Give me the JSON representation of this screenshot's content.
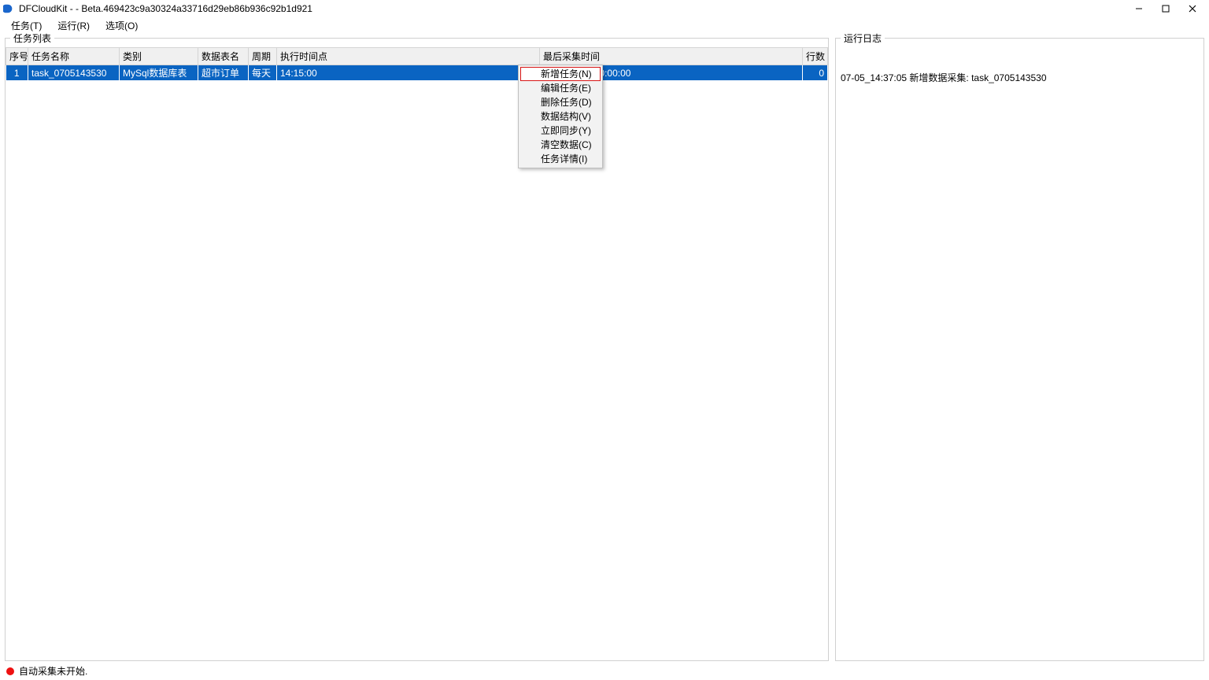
{
  "window": {
    "title": "DFCloudKit - - Beta.469423c9a30324a33716d29eb86b936c92b1d921"
  },
  "menubar": {
    "items": [
      {
        "label": "任务(T)"
      },
      {
        "label": "运行(R)"
      },
      {
        "label": "选项(O)"
      }
    ]
  },
  "panels": {
    "task_list_title": "任务列表",
    "log_title": "运行日志"
  },
  "task_table": {
    "columns": {
      "idx": "序号",
      "name": "任务名称",
      "type": "类别",
      "table": "数据表名",
      "period": "周期",
      "exec_time": "执行时间点",
      "last_collect": "最后采集时间",
      "rows": "行数"
    },
    "rows": [
      {
        "idx": "1",
        "name": "task_0705143530",
        "type": "MySql数据库表",
        "table": "超市订单",
        "period": "每天",
        "exec_time": "14:15:00",
        "last_collect": "0001-01-01 00:00:00",
        "row_count": "0"
      }
    ]
  },
  "context_menu": {
    "items": [
      {
        "label": "新增任务(N)",
        "highlighted": true
      },
      {
        "label": "编辑任务(E)"
      },
      {
        "label": "删除任务(D)"
      },
      {
        "label": "数据结构(V)"
      },
      {
        "label": "立即同步(Y)"
      },
      {
        "label": "清空数据(C)"
      },
      {
        "label": "任务详情(I)"
      }
    ]
  },
  "log": {
    "entries": [
      "07-05_14:37:05 新增数据采集: task_0705143530"
    ]
  },
  "statusbar": {
    "text": "自动采集未开始.",
    "dot_color": "#e11"
  }
}
